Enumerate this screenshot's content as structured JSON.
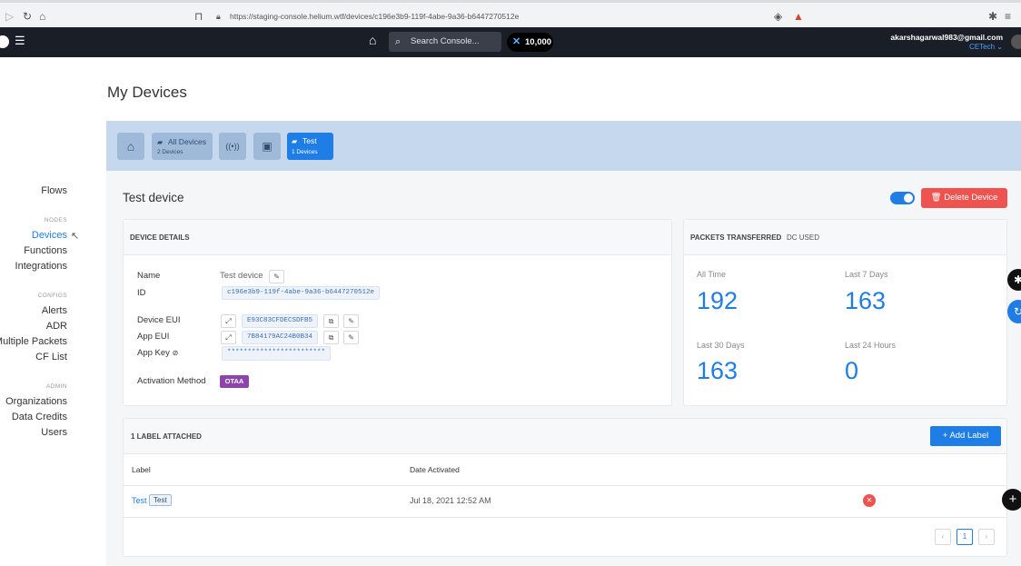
{
  "browser": {
    "url": "https://staging-console.helium.wtf/devices/c196e3b9-119f-4abe-9a36-b6447270512e"
  },
  "header": {
    "search_placeholder": "Search Console...",
    "dc_balance": "10,000",
    "user_email": "akarshagarwal983@gmail.com",
    "org_name": "CETech ⌄"
  },
  "sidebar": {
    "flows": "Flows",
    "nodes_heading": "NODES",
    "devices": "Devices",
    "functions": "Functions",
    "integrations": "Integrations",
    "configs_heading": "CONFIGS",
    "alerts": "Alerts",
    "adr": "ADR",
    "multiple_packets": "Multiple Packets",
    "cf_list": "CF List",
    "admin_heading": "ADMIN",
    "organizations": "Organizations",
    "data_credits": "Data Credits",
    "users": "Users"
  },
  "page": {
    "title": "My Devices",
    "device_title": "Test device",
    "delete_label": "Delete Device"
  },
  "breadcrumbs": {
    "all_devices_title": "All Devices",
    "all_devices_count": "2 Devices",
    "test_title": "Test",
    "test_count": "1 Devices"
  },
  "device_details": {
    "heading": "DEVICE DETAILS",
    "name_label": "Name",
    "name_value": "Test device",
    "id_label": "ID",
    "id_value": "c196e3b9-119f-4abe-9a36-b6447270512e",
    "dev_eui_label": "Device EUI",
    "dev_eui_value": "E93C83CFDECSDFB5",
    "app_eui_label": "App EUI",
    "app_eui_value": "7B84179AC24B0B34",
    "app_key_label": "App Key",
    "app_key_value": "************************",
    "activation_label": "Activation Method",
    "activation_value": "OTAA"
  },
  "packets": {
    "tab_transferred": "PACKETS TRANSFERRED",
    "tab_dc": "DC USED",
    "all_time_label": "All Time",
    "all_time_value": "192",
    "last7_label": "Last 7 Days",
    "last7_value": "163",
    "last30_label": "Last 30 Days",
    "last30_value": "163",
    "last24_label": "Last 24 Hours",
    "last24_value": "0"
  },
  "labels": {
    "heading": "1 LABEL ATTACHED",
    "add_label": "Add Label",
    "col_label": "Label",
    "col_date": "Date Activated",
    "rows": [
      {
        "label_link": "Test",
        "label_tag": "Test",
        "date": "Jul 18, 2021 12:52 AM"
      }
    ],
    "page_number": "1"
  }
}
